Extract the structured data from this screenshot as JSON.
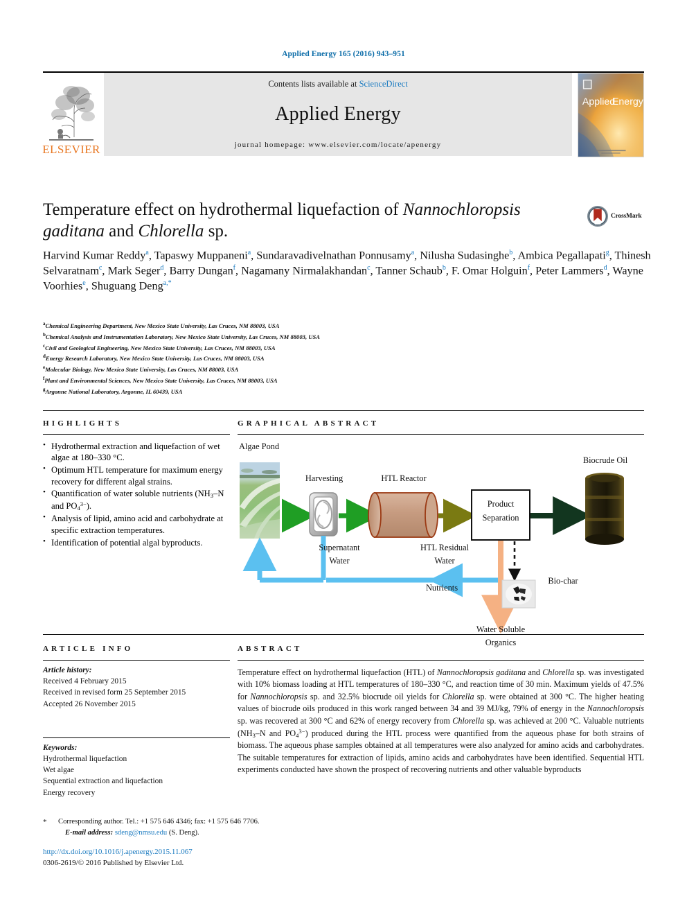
{
  "running_head": "Applied Energy 165 (2016) 943–951",
  "masthead": {
    "publisher_wordmark": "ELSEVIER",
    "contents_prefix": "Contents lists available at ",
    "contents_link": "ScienceDirect",
    "journal_name": "Applied Energy",
    "journal_homepage": "journal homepage: www.elsevier.com/locate/apenergy",
    "cover_title_part1": "Applied",
    "cover_title_part2": "Energy"
  },
  "crossmark": {
    "label": "CrossMark"
  },
  "article": {
    "title_line1_pre": "Temperature effect on hydrothermal liquefaction of ",
    "title_italic1": "Nannochloropsis",
    "title_italic2": "gaditana",
    "title_mid": " and ",
    "title_italic3": "Chlorella",
    "title_end": " sp.",
    "authors_html": "Harvind Kumar Reddy<sup>a</sup>, Tapaswy Muppaneni<sup>a</sup>, Sundaravadivelnathan Ponnusamy<sup>a</sup>, Nilusha Sudasinghe<sup>b</sup>, Ambica Pegallapati<sup>g</sup>, Thinesh Selvaratnam<sup>c</sup>, Mark Seger<sup>d</sup>, Barry Dungan<sup>f</sup>, Nagamany Nirmalakhandan<sup>c</sup>, Tanner Schaub<sup>b</sup>, F. Omar Holguin<sup>f</sup>, Peter Lammers<sup>d</sup>, Wayne Voorhies<sup>e</sup>, Shuguang Deng<sup>a,*</sup>",
    "affiliations": [
      {
        "mark": "a",
        "text": "Chemical Engineering Department, New Mexico State University, Las Cruces, NM 88003, USA"
      },
      {
        "mark": "b",
        "text": "Chemical Analysis and Instrumentation Laboratory, New Mexico State University, Las Cruces, NM 88003, USA"
      },
      {
        "mark": "c",
        "text": "Civil and Geological Engineering, New Mexico State University, Las Cruces, NM 88003, USA"
      },
      {
        "mark": "d",
        "text": "Energy Research Laboratory, New Mexico State University, Las Cruces, NM 88003, USA"
      },
      {
        "mark": "e",
        "text": "Molecular Biology, New Mexico State University, Las Cruces, NM 88003, USA"
      },
      {
        "mark": "f",
        "text": "Plant and Environmental Sciences, New Mexico State University, Las Cruces, NM 88003, USA"
      },
      {
        "mark": "g",
        "text": "Argonne National Laboratory, Argonne, IL 60439, USA"
      }
    ]
  },
  "highlights": {
    "heading": "HIGHLIGHTS",
    "items_html": [
      "Hydrothermal extraction and liquefaction of wet algae at 180–330 °C.",
      "Optimum HTL temperature for maximum energy recovery for different algal strains.",
      "Quantification of water soluble nutrients (NH<sub>3</sub>–N and PO<sub>4</sub><sup>3−</sup>).",
      "Analysis of lipid, amino acid and carbohydrate at specific extraction temperatures.",
      "Identification of potential algal byproducts."
    ]
  },
  "graphical_abstract": {
    "heading": "GRAPHICAL ABSTRACT",
    "labels": {
      "algae_pond": "Algae Pond",
      "harvesting": "Harvesting",
      "htl_reactor": "HTL Reactor",
      "biocrude_oil": "Biocrude Oil",
      "product_separation_l1": "Product",
      "product_separation_l2": "Separation",
      "supernatant_l1": "Supernatant",
      "supernatant_l2": "Water",
      "htl_residual_l1": "HTL Residual",
      "htl_residual_l2": "Water",
      "nutrients": "Nutrients",
      "biochar": "Bio-char",
      "wso_l1": "Water Soluble",
      "wso_l2": "Organics"
    },
    "colors": {
      "pond_green": "#79b36a",
      "flow_green": "#1f9e24",
      "flow_olive": "#7a7a12",
      "flow_dark": "#12361f",
      "water_blue": "#5bc0f0",
      "organics_peach": "#f5b183",
      "reactor_fill": "#c8a08a",
      "reactor_stroke": "#9b3a14"
    }
  },
  "article_info": {
    "heading": "ARTICLE INFO",
    "history_label": "Article history:",
    "history": [
      "Received 4 February 2015",
      "Received in revised form 25 September 2015",
      "Accepted 26 November 2015"
    ],
    "keywords_label": "Keywords:",
    "keywords": [
      "Hydrothermal liquefaction",
      "Wet algae",
      "Sequential extraction and liquefaction",
      "Energy recovery"
    ]
  },
  "abstract": {
    "heading": "ABSTRACT",
    "text_html": "Temperature effect on hydrothermal liquefaction (HTL) of <i>Nannochloropsis gaditana</i> and <i>Chlorella</i> sp. was investigated with 10% biomass loading at HTL temperatures of 180–330 °C, and reaction time of 30 min. Maximum yields of 47.5% for <i>Nannochloropsis</i> sp. and 32.5% biocrude oil yields for <i>Chlorella</i> sp. were obtained at 300 °C. The higher heating values of biocrude oils produced in this work ranged between 34 and 39 MJ/kg, 79% of energy in the <i>Nannochloropsis</i> sp. was recovered at 300 °C and 62% of energy recovery from <i>Chlorella</i> sp. was achieved at 200 °C. Valuable nutrients (NH<sub>3</sub>–N and PO<sub>4</sub><sup>3−</sup>) produced during the HTL process were quantified from the aqueous phase for both strains of biomass. The aqueous phase samples obtained at all temperatures were also analyzed for amino acids and carbohydrates. The suitable temperatures for extraction of lipids, amino acids and carbohydrates have been identified. Sequential HTL experiments conducted have shown the prospect of recovering nutrients and other valuable byproducts"
  },
  "footer": {
    "corresponding_star": "*",
    "corresponding_line": "Corresponding author. Tel.: +1 575 646 4346; fax: +1 575 646 7706.",
    "email_label": "E-mail address:",
    "email": "sdeng@nmsu.edu",
    "email_owner": "(S. Deng).",
    "doi": "http://dx.doi.org/10.1016/j.apenergy.2015.11.067",
    "issn_line": "0306-2619/© 2016 Published by Elsevier Ltd."
  }
}
